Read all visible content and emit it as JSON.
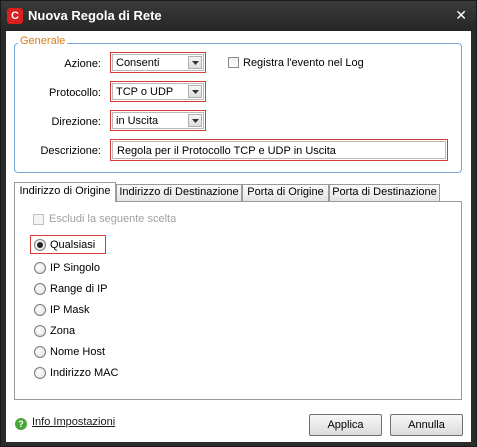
{
  "window": {
    "title": "Nuova Regola di Rete",
    "app_icon_letter": "C"
  },
  "general": {
    "legend": "Generale",
    "action_label": "Azione:",
    "action_value": "Consenti",
    "log_label": "Registra l'evento nel Log",
    "protocol_label": "Protocollo:",
    "protocol_value": "TCP o UDP",
    "direction_label": "Direzione:",
    "direction_value": "in Uscita",
    "description_label": "Descrizione:",
    "description_value": "Regola per il Protocollo TCP e UDP in Uscita"
  },
  "tabs": [
    {
      "label": "Indirizzo di Origine",
      "active": true
    },
    {
      "label": "Indirizzo di Destinazione",
      "active": false
    },
    {
      "label": "Porta di Origine",
      "active": false
    },
    {
      "label": "Porta di Destinazione",
      "active": false
    }
  ],
  "panel": {
    "exclude_label": "Escludi la seguente scelta",
    "options": [
      {
        "label": "Qualsiasi",
        "selected": true
      },
      {
        "label": "IP Singolo",
        "selected": false
      },
      {
        "label": "Range di IP",
        "selected": false
      },
      {
        "label": "IP Mask",
        "selected": false
      },
      {
        "label": "Zona",
        "selected": false
      },
      {
        "label": "Nome Host",
        "selected": false
      },
      {
        "label": "Indirizzo MAC",
        "selected": false
      }
    ]
  },
  "footer": {
    "help_link": "Info Impostazioni",
    "apply_label": "Applica",
    "cancel_label": "Annulla"
  },
  "colors": {
    "title_bar": "#2b2b2b",
    "legend": "#e07a10",
    "highlight_frame": "#d33a3a",
    "group_border": "#7aa7d6",
    "help_icon": "#4aa63a",
    "app_icon": "#d8201e"
  }
}
